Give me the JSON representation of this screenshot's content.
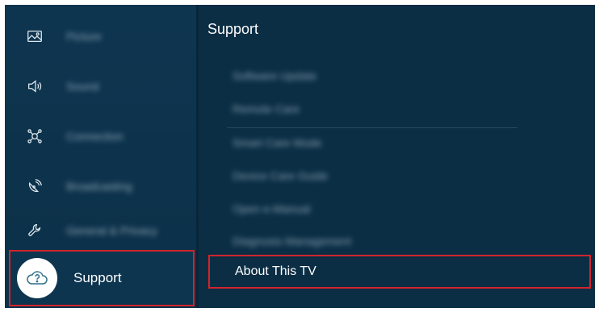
{
  "sidebar": {
    "items": [
      {
        "label": "Picture",
        "icon": "picture-icon"
      },
      {
        "label": "Sound",
        "icon": "sound-icon"
      },
      {
        "label": "Connection",
        "icon": "connection-icon"
      },
      {
        "label": "Broadcasting",
        "icon": "broadcasting-icon"
      },
      {
        "label": "General & Privacy",
        "icon": "wrench-icon"
      }
    ],
    "selected": {
      "label": "Support",
      "icon": "support-cloud-icon"
    }
  },
  "panel": {
    "title": "Support",
    "items": [
      {
        "label": "Software Update"
      },
      {
        "label": "Remote Care"
      },
      {
        "label": "Smart Care Mode"
      },
      {
        "label": "Device Care Guide"
      },
      {
        "label": "Open e-Manual"
      },
      {
        "label": "Diagnosis Management"
      }
    ],
    "selected_label": "About This TV"
  },
  "colors": {
    "background": "#0a2c42",
    "highlight_border": "#d2242a",
    "text": "#ffffff"
  }
}
